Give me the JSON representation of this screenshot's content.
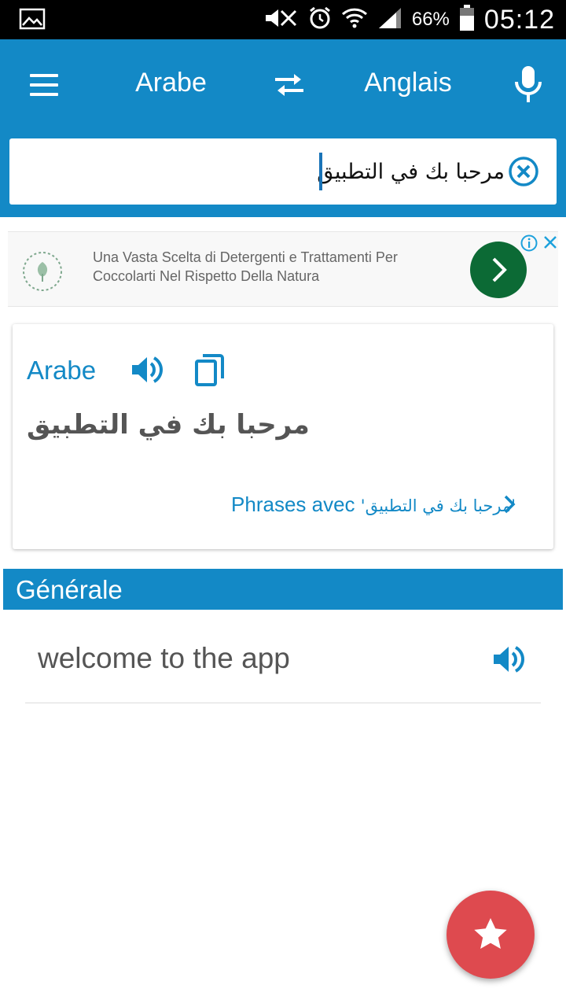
{
  "status_bar": {
    "battery_percent": "66%",
    "time": "05:12",
    "icons": [
      "image-icon",
      "mute-icon",
      "alarm-icon",
      "wifi-icon",
      "signal-icon",
      "battery-icon"
    ]
  },
  "app_bar": {
    "menu_icon": "hamburger-icon",
    "source_language": "Arabe",
    "swap_icon": "swap-arrows-icon",
    "target_language": "Anglais",
    "mic_icon": "microphone-icon"
  },
  "search": {
    "value": "مرحبا بك في التطبيق",
    "clear_icon": "clear-circle-icon"
  },
  "ad": {
    "text_line1": "Una Vasta Scelta di Detergenti e Trattamenti Per",
    "text_line2": "Coccolarti Nel Rispetto Della Natura",
    "go_icon": "chevron-right-icon",
    "info_icon": "info-icon",
    "close_icon": "close-icon"
  },
  "result_card": {
    "language": "Arabe",
    "speak_icon": "speaker-icon",
    "copy_icon": "copy-icon",
    "source_text": "مرحبا بك في التطبيق",
    "phrases_prefix": "Phrases avec ",
    "phrases_term": "'مرحبا بك في التطبيق'",
    "phrases_icon": "chevron-right-icon"
  },
  "section": {
    "title": "Générale"
  },
  "translations": [
    {
      "text": "welcome to the app",
      "speak_icon": "speaker-icon"
    }
  ],
  "fab": {
    "icon": "star-icon",
    "color": "#de4a4f"
  },
  "colors": {
    "primary": "#1389c6",
    "ad_button": "#0c6a35",
    "fab": "#de4a4f"
  }
}
